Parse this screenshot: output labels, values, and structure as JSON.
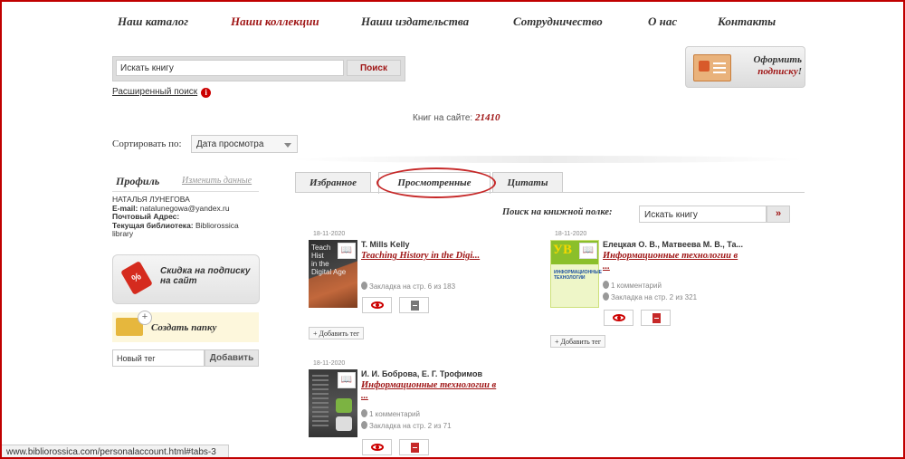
{
  "nav": {
    "items": [
      {
        "label": "Наш каталог",
        "active": false
      },
      {
        "label": "Наши коллекции",
        "active": true
      },
      {
        "label": "Наши издательства",
        "active": false
      },
      {
        "label": "Сотрудничество",
        "active": false
      },
      {
        "label": "О нас",
        "active": false
      },
      {
        "label": "Контакты",
        "active": false
      }
    ]
  },
  "search": {
    "value": "Искать книгу",
    "button_label": "Поиск",
    "advanced_link": "Расширенный поиск",
    "info_icon": "i"
  },
  "subscribe": {
    "line1": "Оформить",
    "line2": "подписку",
    "exclam": "!"
  },
  "count": {
    "label": "Книг на сайте:",
    "value": "21410"
  },
  "sort": {
    "label": "Сортировать по:",
    "selected": "Дата просмотра"
  },
  "profile": {
    "title": "Профиль",
    "edit_link": "Изменить данные",
    "name": "НАТАЛЬЯ ЛУНЕГОВА",
    "email_label": "E-mail:",
    "email": "natalunegowa@yandex.ru",
    "address_label": "Почтовый Адрес:",
    "library_label": "Текущая библиотека:",
    "library": "Bibliorossica library"
  },
  "discount": {
    "line1": "Скидка на подписку",
    "line2": "на сайт",
    "icon": "%"
  },
  "folder": {
    "label": "Создать папку",
    "plus": "+"
  },
  "tag": {
    "placeholder": "Новый тег",
    "button_label": "Добавить"
  },
  "tabs": [
    {
      "label": "Избранное",
      "active": false
    },
    {
      "label": "Просмотренные",
      "active": true
    },
    {
      "label": "Цитаты",
      "active": false
    }
  ],
  "shelf": {
    "label": "Поиск на книжной полке:",
    "value": "Искать книгу",
    "button_label": "»"
  },
  "books": [
    {
      "date": "18-11-2020",
      "author": "T. Mills Kelly",
      "title": "Teaching History in the Digi...",
      "title_cont": "",
      "comments": "",
      "bookmark": "Закладка на стр. 6 из 183",
      "cover_text": "Teach\nHist\nin the\nDigital Age",
      "add_tag": "+ Добавить тег"
    },
    {
      "date": "18-11-2020",
      "author": "Елецкая О. В., Матвеева М. В., Та...",
      "title": "Информационные технологии в",
      "title_cont": "...",
      "comments": "1 комментарий",
      "bookmark": "Закладка на стр. 2 из 321",
      "cover_letters": "УВ",
      "cover_text": "ИНФОРМАЦИОННЫЕ ТЕХНОЛОГИИ",
      "add_tag": "+ Добавить тег"
    },
    {
      "date": "18-11-2020",
      "author": "И. И. Боброва, Е. Г. Трофимов",
      "title": "Информационные технологии в",
      "title_cont": "...",
      "comments": "1 комментарий",
      "bookmark": "Закладка на стр. 2 из 71"
    }
  ],
  "status_bar": "www.bibliorossica.com/personalaccount.html#tabs-3"
}
